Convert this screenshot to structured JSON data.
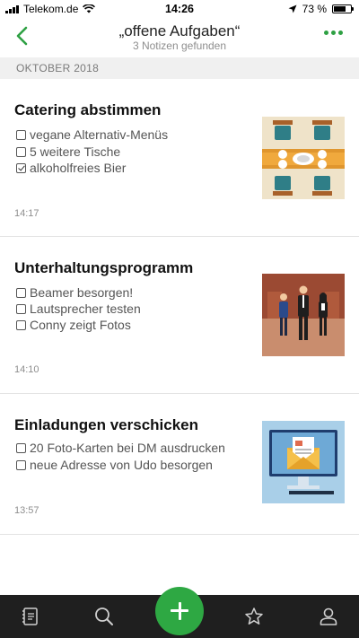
{
  "status_bar": {
    "carrier": "Telekom.de",
    "time": "14:26",
    "battery": "73 %",
    "battery_level": 0.73
  },
  "nav": {
    "title": "„offene Aufgaben“",
    "subtitle": "3 Notizen gefunden",
    "accent_color": "#2ea043"
  },
  "section": {
    "label": "OKTOBER 2018"
  },
  "notes": [
    {
      "title": "Catering abstimmen",
      "todos": [
        {
          "text": "vegane Alternativ-Menüs",
          "checked": false
        },
        {
          "text": "5 weitere Tische",
          "checked": false
        },
        {
          "text": "alkoholfreies Bier",
          "checked": true
        }
      ],
      "time": "14:17",
      "thumbnail": "dining-table-illustration"
    },
    {
      "title": "Unterhaltungsprogramm",
      "todos": [
        {
          "text": "Beamer besorgen!",
          "checked": false
        },
        {
          "text": "Lautsprecher testen",
          "checked": false
        },
        {
          "text": "Conny zeigt Fotos",
          "checked": false
        }
      ],
      "time": "14:10",
      "thumbnail": "people-meeting-illustration"
    },
    {
      "title": "Einladungen verschicken",
      "todos": [
        {
          "text": "20 Foto-Karten bei DM ausdrucken",
          "checked": false
        },
        {
          "text": "neue Adresse von Udo besorgen",
          "checked": false
        }
      ],
      "time": "13:57",
      "thumbnail": "email-monitor-illustration"
    }
  ],
  "tabbar": {
    "items": [
      "notes-icon",
      "search-icon",
      "add-icon",
      "star-icon",
      "account-icon"
    ]
  }
}
